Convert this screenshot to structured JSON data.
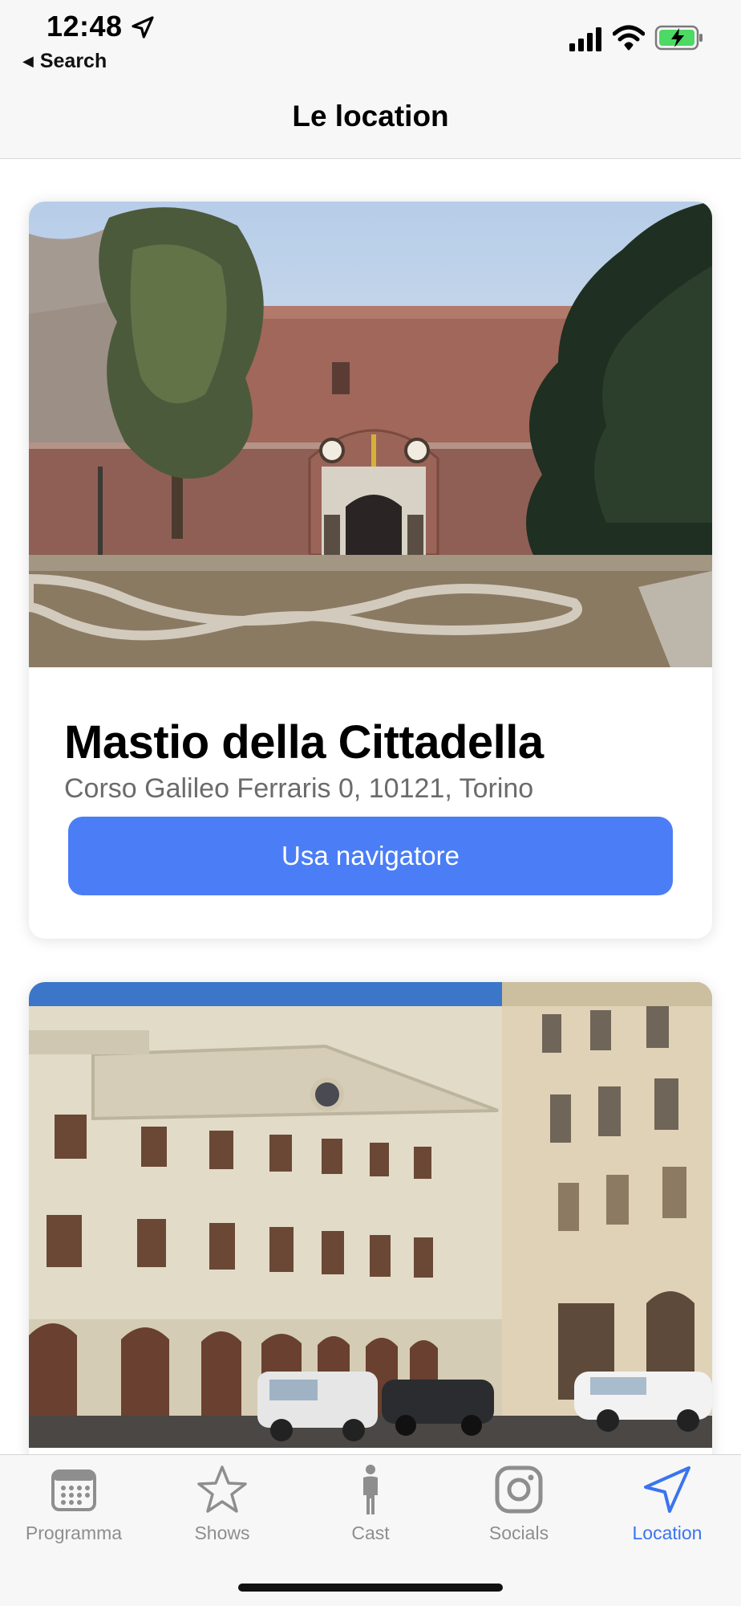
{
  "status_bar": {
    "time": "12:48",
    "back_label": "Search",
    "icons": [
      "location-arrow-icon",
      "cellular-signal-icon",
      "wifi-icon",
      "battery-charging-icon"
    ],
    "battery_color": "#4cd964"
  },
  "nav": {
    "title": "Le location"
  },
  "locations": [
    {
      "name": "Mastio della Cittadella",
      "address": "Corso Galileo Ferraris 0, 10121, Torino",
      "button_label": "Usa navigatore",
      "photo": "brick-fortress-photo"
    },
    {
      "photo": "historic-theatre-building-photo"
    }
  ],
  "tabs": [
    {
      "label": "Programma",
      "icon": "calendar-icon",
      "active": false
    },
    {
      "label": "Shows",
      "icon": "star-icon",
      "active": false
    },
    {
      "label": "Cast",
      "icon": "person-icon",
      "active": false
    },
    {
      "label": "Socials",
      "icon": "instagram-icon",
      "active": false
    },
    {
      "label": "Location",
      "icon": "location-arrow-icon",
      "active": true
    }
  ],
  "colors": {
    "accent": "#4b7ef6",
    "tab_active": "#3a74f0",
    "tab_inactive": "#8e8e8e",
    "bars_background": "#f7f7f7"
  }
}
